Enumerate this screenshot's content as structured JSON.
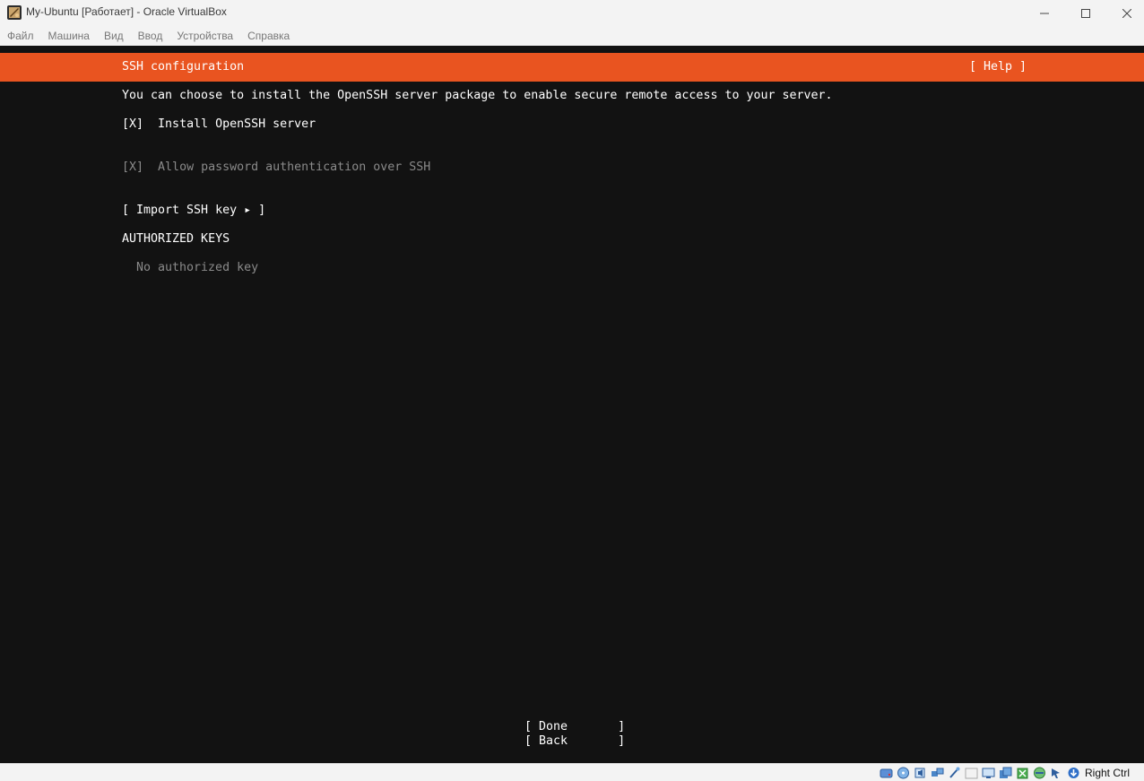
{
  "window": {
    "title": "My-Ubuntu [Работает] - Oracle VirtualBox",
    "icon": "virtualbox-app-icon",
    "controls": [
      "minimize-icon",
      "maximize-icon",
      "close-icon"
    ]
  },
  "menubar": {
    "items": [
      "Файл",
      "Машина",
      "Вид",
      "Ввод",
      "Устройства",
      "Справка"
    ]
  },
  "installer": {
    "header_title": "SSH configuration",
    "help_label": "[ Help ]",
    "description": "You can choose to install the OpenSSH server package to enable secure remote access to your server.",
    "install_openssh": {
      "mark": "[X]",
      "label": "Install OpenSSH server",
      "checked": true
    },
    "allow_password": {
      "mark": "[X]",
      "label": "Allow password authentication over SSH",
      "checked": true,
      "disabled": true
    },
    "import_key_label": "[ Import SSH key ▸ ]",
    "authorized_keys_heading": "AUTHORIZED KEYS",
    "no_keys_text": "No authorized key",
    "done_label": "[ Done       ]",
    "back_label": "[ Back       ]",
    "accent_color": "#e95420",
    "background_color": "#121212"
  },
  "statusbar": {
    "icons": [
      "hard-disk-icon",
      "optical-drive-icon",
      "audio-icon",
      "network-icon",
      "usb-icon",
      "shared-folders-icon",
      "display-icon",
      "recording-icon",
      "cpu-virtualization-icon",
      "guest-additions-icon",
      "mouse-integration-icon",
      "keyboard-capture-icon"
    ],
    "host_key": "Right Ctrl"
  }
}
